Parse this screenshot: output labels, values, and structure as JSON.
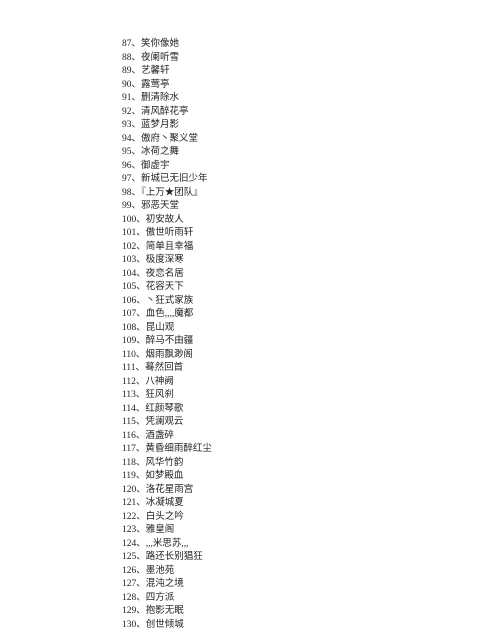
{
  "separator": "、",
  "items": [
    {
      "n": 87,
      "t": "笑你像她"
    },
    {
      "n": 88,
      "t": "夜阑听雪"
    },
    {
      "n": 89,
      "t": "艺馨轩"
    },
    {
      "n": 90,
      "t": "露莺亭"
    },
    {
      "n": 91,
      "t": "删清除水"
    },
    {
      "n": 92,
      "t": "清风醉花亭"
    },
    {
      "n": 93,
      "t": "蓝梦月影"
    },
    {
      "n": 94,
      "t": "傲府丶聚义堂"
    },
    {
      "n": 95,
      "t": "冰荷之舞"
    },
    {
      "n": 96,
      "t": "御虚宇"
    },
    {
      "n": 97,
      "t": "新城已无旧少年"
    },
    {
      "n": 98,
      "t": "『上万★团队』"
    },
    {
      "n": 99,
      "t": "邪恶天堂"
    },
    {
      "n": 100,
      "t": "初安故人"
    },
    {
      "n": 101,
      "t": "傲世听雨轩"
    },
    {
      "n": 102,
      "t": "简单且幸福"
    },
    {
      "n": 103,
      "t": "极度深寒"
    },
    {
      "n": 104,
      "t": "夜恋名居"
    },
    {
      "n": 105,
      "t": "花容天下"
    },
    {
      "n": 106,
      "t": "丶狂式家族"
    },
    {
      "n": 107,
      "t": "血色,,,,魔都"
    },
    {
      "n": 108,
      "t": "昆山观"
    },
    {
      "n": 109,
      "t": "醉马不由疆"
    },
    {
      "n": 110,
      "t": "烟雨飘渺阁"
    },
    {
      "n": 111,
      "t": "蓦然回首"
    },
    {
      "n": 112,
      "t": "八神阙"
    },
    {
      "n": 113,
      "t": "狂风刹"
    },
    {
      "n": 114,
      "t": "红颜琴歌"
    },
    {
      "n": 115,
      "t": "凭澜观云"
    },
    {
      "n": 116,
      "t": "酒盏碎"
    },
    {
      "n": 117,
      "t": "黄昏细雨醉红尘"
    },
    {
      "n": 118,
      "t": "风华竹韵"
    },
    {
      "n": 119,
      "t": "如梦殿血"
    },
    {
      "n": 120,
      "t": "洛花星雨宫"
    },
    {
      "n": 121,
      "t": "冰凝城夏"
    },
    {
      "n": 122,
      "t": "白头之吟"
    },
    {
      "n": 123,
      "t": "雅皇阁"
    },
    {
      "n": 124,
      "t": ",,,米思苏,,,"
    },
    {
      "n": 125,
      "t": "路还长别猖狂"
    },
    {
      "n": 126,
      "t": "墨池苑"
    },
    {
      "n": 127,
      "t": "混沌之境"
    },
    {
      "n": 128,
      "t": "四方派"
    },
    {
      "n": 129,
      "t": "抱影无眠"
    },
    {
      "n": 130,
      "t": "创世倾城"
    }
  ]
}
